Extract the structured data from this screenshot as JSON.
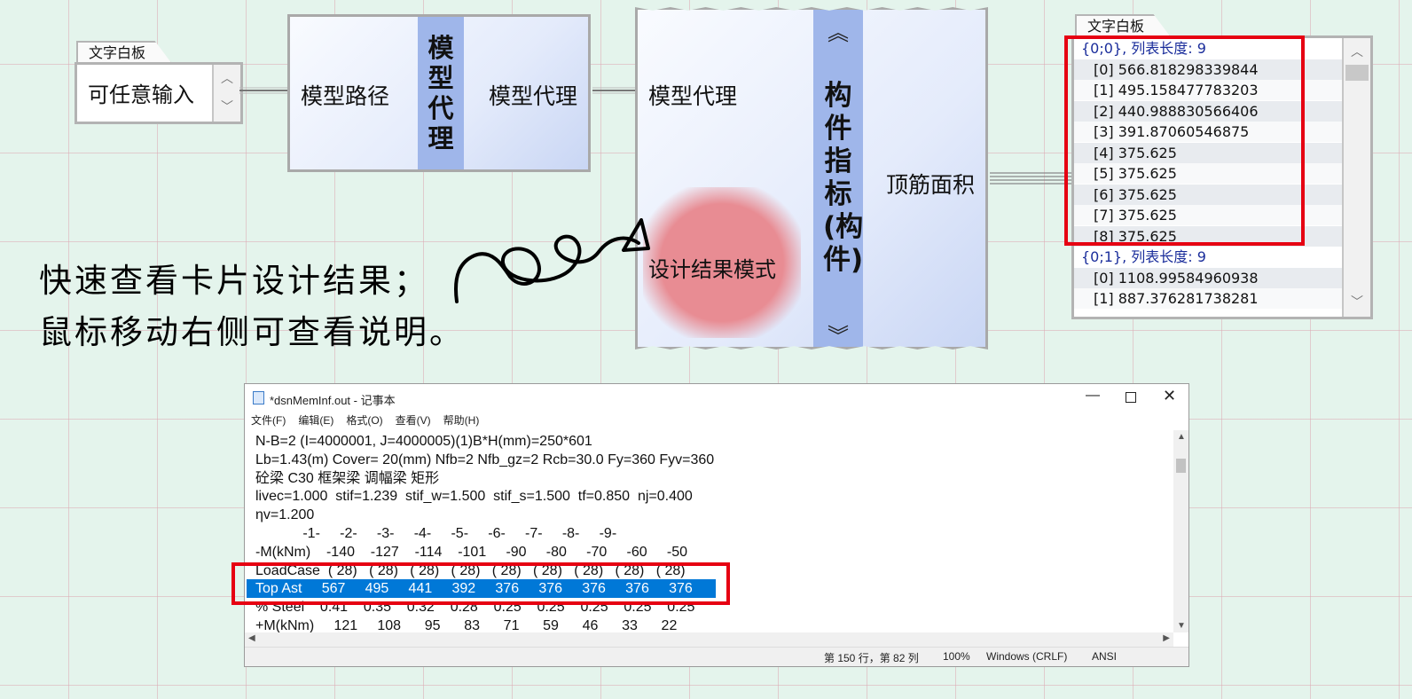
{
  "panel_input": {
    "tab": "文字白板",
    "text": "可任意输入"
  },
  "comp_path": {
    "input_label": "模型路径",
    "title": "模型代理",
    "output_label": "模型代理"
  },
  "comp_member": {
    "input_top": "模型代理",
    "input_bottom": "设计结果模式",
    "title": "构件指标(构件)",
    "output_label": "顶筋面积"
  },
  "panel_output": {
    "tab": "文字白板",
    "lines": [
      {
        "text": "{0;0}, 列表长度: 9",
        "kind": "header"
      },
      {
        "text": "[0] 566.818298339844",
        "kind": "item"
      },
      {
        "text": "[1] 495.158477783203",
        "kind": "item"
      },
      {
        "text": "[2] 440.988830566406",
        "kind": "item"
      },
      {
        "text": "[3] 391.87060546875",
        "kind": "item"
      },
      {
        "text": "[4] 375.625",
        "kind": "item"
      },
      {
        "text": "[5] 375.625",
        "kind": "item"
      },
      {
        "text": "[6] 375.625",
        "kind": "item"
      },
      {
        "text": "[7] 375.625",
        "kind": "item"
      },
      {
        "text": "[8] 375.625",
        "kind": "item"
      },
      {
        "text": "{0;1}, 列表长度: 9",
        "kind": "header"
      },
      {
        "text": "[0] 1108.99584960938",
        "kind": "item"
      },
      {
        "text": "[1] 887.376281738281",
        "kind": "item"
      }
    ]
  },
  "note": {
    "line1": "快速查看卡片设计结果；",
    "line2": "鼠标移动右侧可查看说明。"
  },
  "notepad": {
    "title": "*dsnMemInf.out - 记事本",
    "menu": [
      "文件(F)",
      "编辑(E)",
      "格式(O)",
      "查看(V)",
      "帮助(H)"
    ],
    "lines": [
      "N-B=2 (I=4000001, J=4000005)(1)B*H(mm)=250*601",
      "Lb=1.43(m) Cover= 20(mm) Nfb=2 Nfb_gz=2 Rcb=30.0 Fy=360 Fyv=360",
      "砼梁 C30 框架梁 调幅梁 矩形",
      "livec=1.000  stif=1.239  stif_w=1.500  stif_s=1.500  tf=0.850  nj=0.400",
      "ηv=1.200",
      "            -1-     -2-     -3-     -4-     -5-     -6-     -7-     -8-     -9-",
      "-M(kNm)    -140    -127    -114    -101     -90     -80     -70     -60     -50",
      "LoadCase  ( 28)   ( 28)   ( 28)   ( 28)   ( 28)   ( 28)   ( 28)   ( 28)   ( 28)",
      "Top Ast     567     495     441     392     376     376     376     376     376",
      "% Steel    0.41    0.35    0.32    0.28    0.25    0.25    0.25    0.25    0.25",
      "+M(kNm)     121     108      95      83      71      59      46      33      22"
    ],
    "highlight_line": 8,
    "status": {
      "position": "第 150 行，第 82 列",
      "zoom": "100%",
      "eol": "Windows (CRLF)",
      "encoding": "ANSI"
    }
  },
  "colors": {
    "highlight": "#0078d7",
    "red_box": "#e60012",
    "header_text": "#1a2d9b"
  }
}
